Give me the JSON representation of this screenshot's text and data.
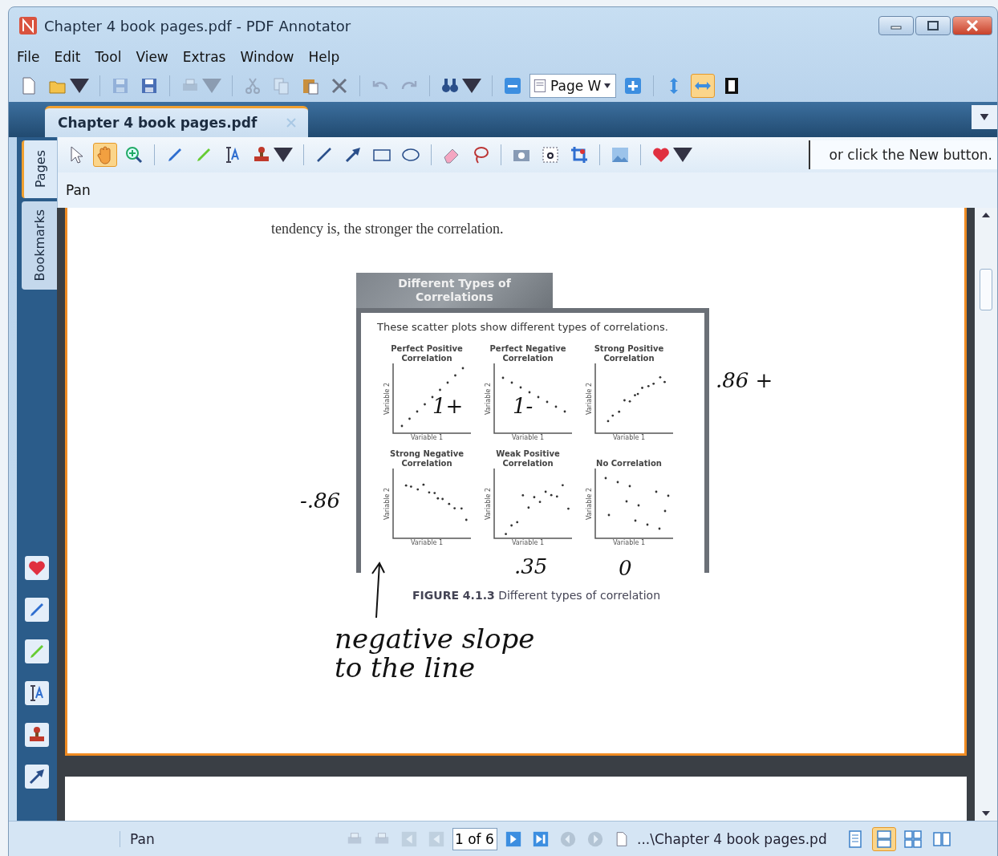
{
  "window": {
    "title": "Chapter 4 book pages.pdf - PDF Annotator"
  },
  "menu": [
    {
      "label": "File"
    },
    {
      "label": "Edit"
    },
    {
      "label": "Tool"
    },
    {
      "label": "View"
    },
    {
      "label": "Extras"
    },
    {
      "label": "Window"
    },
    {
      "label": "Help"
    }
  ],
  "toolbar": [
    [
      {
        "kind": "new",
        "disabled": false,
        "selected": false,
        "dropdown": false
      },
      {
        "kind": "open",
        "disabled": false,
        "selected": false,
        "dropdown": true
      }
    ],
    [
      {
        "kind": "save",
        "disabled": true,
        "selected": false,
        "dropdown": false
      },
      {
        "kind": "save",
        "disabled": false,
        "selected": false,
        "dropdown": false
      }
    ],
    [
      {
        "kind": "print",
        "disabled": true,
        "selected": false,
        "dropdown": true
      }
    ],
    [
      {
        "kind": "cut",
        "disabled": true,
        "selected": false,
        "dropdown": false
      },
      {
        "kind": "copy",
        "disabled": true,
        "selected": false,
        "dropdown": false
      },
      {
        "kind": "paste",
        "disabled": false,
        "selected": false,
        "dropdown": false
      },
      {
        "kind": "delete",
        "disabled": false,
        "selected": false,
        "dropdown": false
      }
    ],
    [
      {
        "kind": "undo",
        "disabled": true,
        "selected": false,
        "dropdown": false
      },
      {
        "kind": "redo",
        "disabled": true,
        "selected": false,
        "dropdown": false
      }
    ],
    [
      {
        "kind": "find",
        "disabled": false,
        "selected": false,
        "dropdown": true
      }
    ],
    [
      {
        "kind": "zoom-out",
        "disabled": false,
        "selected": false,
        "dropdown": false
      },
      {
        "kind": "zoom-select",
        "disabled": false,
        "selected": false,
        "dropdown": true,
        "label": "Page W"
      },
      {
        "kind": "zoom-in",
        "disabled": false,
        "selected": false,
        "dropdown": false
      }
    ],
    [
      {
        "kind": "fit-height",
        "disabled": false,
        "selected": false,
        "dropdown": false
      },
      {
        "kind": "fit-width",
        "disabled": false,
        "selected": true,
        "dropdown": false
      },
      {
        "kind": "full-page",
        "disabled": false,
        "selected": false,
        "dropdown": false
      }
    ]
  ],
  "document_tab": {
    "label": "Chapter 4 book pages.pdf",
    "selected": true
  },
  "side_tabs": [
    {
      "label": "Pages",
      "selected": true
    },
    {
      "label": "Bookmarks",
      "selected": false
    }
  ],
  "favorites": [
    {
      "kind": "heart"
    },
    {
      "kind": "pen"
    },
    {
      "kind": "highlighter"
    },
    {
      "kind": "text"
    },
    {
      "kind": "stamp"
    },
    {
      "kind": "arrow"
    }
  ],
  "annotation_toolbar": [
    [
      {
        "kind": "select",
        "selected": false,
        "dropdown": false
      },
      {
        "kind": "pan",
        "selected": true,
        "dropdown": false
      },
      {
        "kind": "zoom",
        "selected": false,
        "dropdown": false
      }
    ],
    [
      {
        "kind": "pen",
        "selected": false,
        "dropdown": false
      },
      {
        "kind": "highlighter",
        "selected": false,
        "dropdown": false
      },
      {
        "kind": "text",
        "selected": false,
        "dropdown": false
      },
      {
        "kind": "stamp",
        "selected": false,
        "dropdown": true
      }
    ],
    [
      {
        "kind": "line",
        "selected": false,
        "dropdown": false
      },
      {
        "kind": "arrow",
        "selected": false,
        "dropdown": false
      },
      {
        "kind": "rectangle",
        "selected": false,
        "dropdown": false
      },
      {
        "kind": "ellipse",
        "selected": false,
        "dropdown": false
      }
    ],
    [
      {
        "kind": "eraser",
        "selected": false,
        "dropdown": false
      },
      {
        "kind": "lasso",
        "selected": false,
        "dropdown": false
      }
    ],
    [
      {
        "kind": "snapshot",
        "selected": false,
        "dropdown": false
      },
      {
        "kind": "text-select",
        "selected": false,
        "dropdown": false
      },
      {
        "kind": "crop",
        "selected": false,
        "dropdown": false
      }
    ],
    [
      {
        "kind": "image",
        "selected": false,
        "dropdown": false
      }
    ],
    [
      {
        "kind": "heart",
        "selected": false,
        "dropdown": true
      }
    ]
  ],
  "hint": "or click the New button.",
  "tool_name": "Pan",
  "page": {
    "paragraph": "tendency is, the stronger the correlation.",
    "figure": {
      "header": "Different Types of Correlations",
      "intro": "These scatter plots show different types of correlations.",
      "plots": [
        {
          "title": "Perfect Positive Correlation",
          "kind": "perfect-positive",
          "ylabel": "Variable 2",
          "xlabel": "Variable 1"
        },
        {
          "title": "Perfect Negative Correlation",
          "kind": "perfect-negative",
          "ylabel": "Variable 2",
          "xlabel": "Variable 1"
        },
        {
          "title": "Strong Positive Correlation",
          "kind": "strong-positive",
          "ylabel": "Variable 2",
          "xlabel": "Variable 1"
        },
        {
          "title": "Strong Negative Correlation",
          "kind": "strong-negative",
          "ylabel": "Variable 2",
          "xlabel": "Variable 1"
        },
        {
          "title": "Weak Positive Correlation",
          "kind": "weak-positive",
          "ylabel": "Variable 2",
          "xlabel": "Variable 1"
        },
        {
          "title": "No Correlation",
          "kind": "none",
          "ylabel": "Variable 2",
          "xlabel": "Variable 1"
        }
      ],
      "caption": "**FIGURE 4.1.3** Different types of correlation"
    },
    "notes": [
      {
        "text": "1+",
        "kind": "small"
      },
      {
        "text": "1-",
        "kind": "small"
      },
      {
        "text": ".86 +",
        "kind": "small"
      },
      {
        "text": "-.86",
        "kind": "small"
      },
      {
        "text": ".35",
        "kind": "small"
      },
      {
        "text": "0",
        "kind": "small"
      },
      {
        "text": "negative slope\nto the line",
        "kind": "large"
      }
    ]
  },
  "status_bar": {
    "tool": "Pan",
    "page_field": "1 of 6",
    "file": "...\\Chapter 4 book pages.pd",
    "view_modes": [
      {
        "kind": "single",
        "selected": false
      },
      {
        "kind": "continuous",
        "selected": true
      },
      {
        "kind": "facing",
        "selected": false
      },
      {
        "kind": "two-page",
        "selected": false
      }
    ]
  }
}
